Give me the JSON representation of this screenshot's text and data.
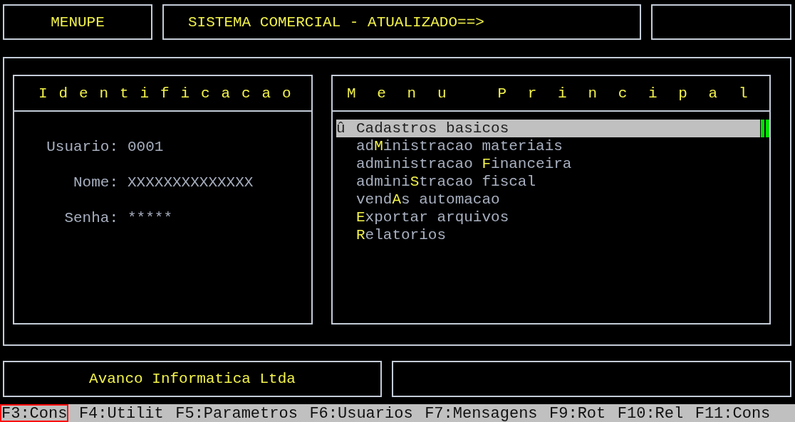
{
  "header": {
    "program": "MENUPE",
    "title": "SISTEMA COMERCIAL - ATUALIZADO==>"
  },
  "identification": {
    "title": "Identificacao",
    "fields": [
      {
        "label": "Usuario:",
        "value": "0001"
      },
      {
        "label": "Nome:",
        "value": "XXXXXXXXXXXXXX"
      },
      {
        "label": "Senha:",
        "value": "*****"
      }
    ]
  },
  "menu": {
    "title": "Menu Principal",
    "items": [
      {
        "marker": "û",
        "key": "C",
        "after": "adastros basicos",
        "selected": true
      },
      {
        "before": "ad",
        "key": "M",
        "after": "inistracao materiais",
        "selected": false
      },
      {
        "before": "administracao ",
        "key": "F",
        "after": "inanceira",
        "selected": false
      },
      {
        "before": "admini",
        "key": "S",
        "after": "tracao fiscal",
        "selected": false
      },
      {
        "before": "vend",
        "key": "A",
        "after": "s automacao",
        "selected": false
      },
      {
        "key": "E",
        "after": "xportar arquivos",
        "selected": false
      },
      {
        "key": "R",
        "after": "elatorios",
        "selected": false
      }
    ]
  },
  "footer": {
    "company": "Avanco Informatica Ltda"
  },
  "function_keys": [
    {
      "label": "F3:Cons",
      "selected": true
    },
    {
      "label": "F4:Utilit",
      "selected": false
    },
    {
      "label": "F5:Parametros",
      "selected": false
    },
    {
      "label": "F6:Usuarios",
      "selected": false
    },
    {
      "label": "F7:Mensagens",
      "selected": false
    },
    {
      "label": "F9:Rot",
      "selected": false
    },
    {
      "label": "F10:Rel",
      "selected": false
    },
    {
      "label": "F11:Cons",
      "selected": false
    }
  ]
}
